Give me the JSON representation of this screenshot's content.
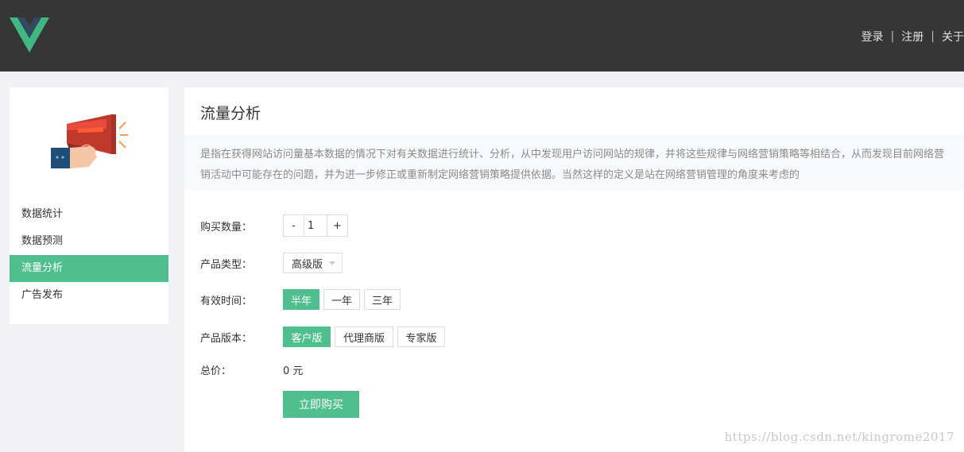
{
  "header": {
    "nav": [
      {
        "label": "登录"
      },
      {
        "label": "注册"
      },
      {
        "label": "关于"
      }
    ],
    "separator": "|",
    "colors": {
      "bg": "#363636",
      "logo_outer": "#41b883",
      "logo_inner": "#35495e"
    }
  },
  "sidebar": {
    "image_icon": "megaphone-icon",
    "items": [
      {
        "label": "数据统计",
        "active": false
      },
      {
        "label": "数据预测",
        "active": false
      },
      {
        "label": "流量分析",
        "active": true
      },
      {
        "label": "广告发布",
        "active": false
      }
    ]
  },
  "main": {
    "title": "流量分析",
    "description": "是指在获得网站访问量基本数据的情况下对有关数据进行统计、分析，从中发现用户访问网站的规律，并将这些规律与网络营销策略等相结合，从而发现目前网络营销活动中可能存在的问题，并为进一步修正或重新制定网络营销策略提供依据。当然这样的定义是站在网络营销管理的角度来考虑的",
    "quantity": {
      "label": "购买数量：",
      "minus": "-",
      "value": "1",
      "plus": "+"
    },
    "product_type": {
      "label": "产品类型：",
      "selected": "高级版"
    },
    "duration": {
      "label": "有效时间：",
      "options": [
        "半年",
        "一年",
        "三年"
      ],
      "selected_index": 0
    },
    "edition": {
      "label": "产品版本：",
      "options": [
        "客户版",
        "代理商版",
        "专家版"
      ],
      "selected_index": 0
    },
    "total": {
      "label": "总价：",
      "value": "0 元"
    },
    "buy_button": "立即购买",
    "accent": "#4fc08d"
  },
  "watermark": "https://blog.csdn.net/kingrome2017"
}
